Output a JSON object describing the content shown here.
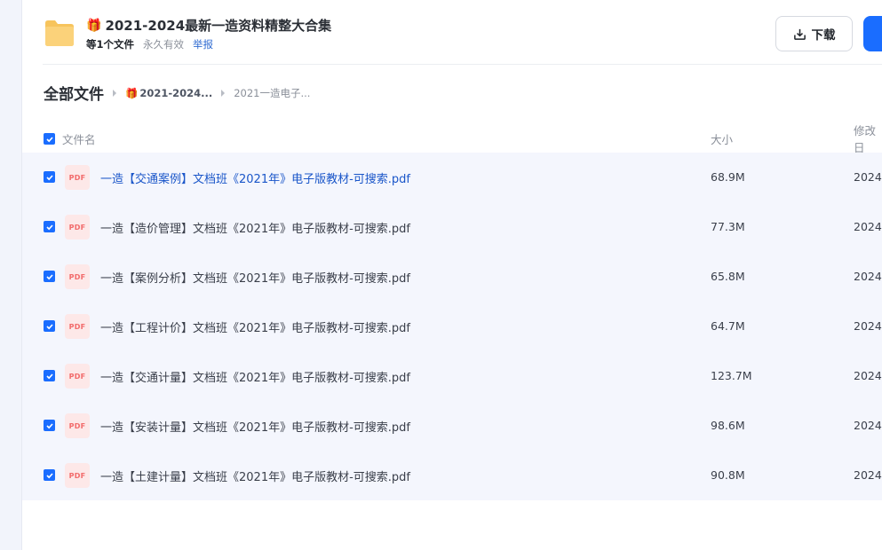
{
  "header": {
    "gift_icon": "🎁",
    "title": "2021-2024最新一造资料精整大合集",
    "file_count": "等1个文件",
    "validity": "永久有效",
    "report": "举报",
    "download_label": "下载"
  },
  "breadcrumb": {
    "root": "全部文件",
    "items": [
      {
        "icon": "🎁",
        "label": "2021-2024..."
      },
      {
        "icon": "",
        "label": "2021一造电子..."
      }
    ]
  },
  "table": {
    "headers": {
      "name": "文件名",
      "size": "大小",
      "date": "修改日"
    },
    "rows": [
      {
        "type": "PDF",
        "name": "一造【交通案例】文档班《2021年》电子版教材-可搜索.pdf",
        "size": "68.9M",
        "date": "2024"
      },
      {
        "type": "PDF",
        "name": "一造【造价管理】文档班《2021年》电子版教材-可搜索.pdf",
        "size": "77.3M",
        "date": "2024"
      },
      {
        "type": "PDF",
        "name": "一造【案例分析】文档班《2021年》电子版教材-可搜索.pdf",
        "size": "65.8M",
        "date": "2024"
      },
      {
        "type": "PDF",
        "name": "一造【工程计价】文档班《2021年》电子版教材-可搜索.pdf",
        "size": "64.7M",
        "date": "2024"
      },
      {
        "type": "PDF",
        "name": "一造【交通计量】文档班《2021年》电子版教材-可搜索.pdf",
        "size": "123.7M",
        "date": "2024"
      },
      {
        "type": "PDF",
        "name": "一造【安装计量】文档班《2021年》电子版教材-可搜索.pdf",
        "size": "98.6M",
        "date": "2024"
      },
      {
        "type": "PDF",
        "name": "一造【土建计量】文档班《2021年》电子版教材-可搜索.pdf",
        "size": "90.8M",
        "date": "2024"
      }
    ]
  }
}
